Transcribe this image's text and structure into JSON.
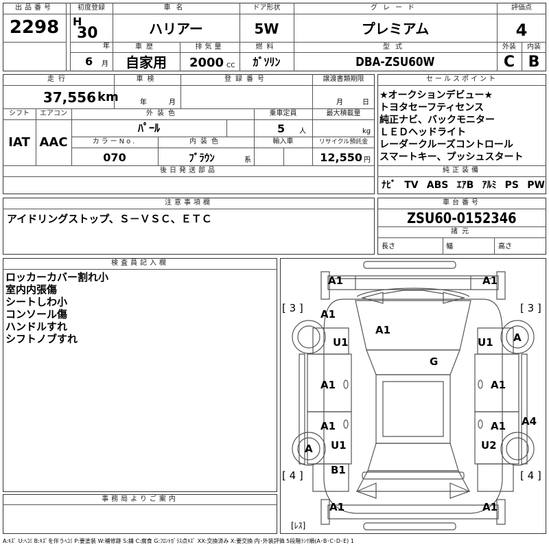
{
  "header": {
    "lot_label": "出品番号",
    "lot": "2298",
    "first_reg_label": "初度登録",
    "era": "H",
    "year": "30",
    "year_unit": "年",
    "month": "6",
    "month_unit": "月",
    "car_name_label": "車名",
    "car_name": "ハリアー",
    "door_label": "ドア形状",
    "door": "5W",
    "grade_label": "グレード",
    "grade": "プレミアム",
    "score_label": "評価点",
    "score": "4",
    "history_label": "車歴",
    "history": "自家用",
    "displacement_label": "排気量",
    "displacement": "2000",
    "displacement_unit": "CC",
    "fuel_label": "燃料",
    "fuel": "ｶﾞｿﾘﾝ",
    "model_label": "型式",
    "model": "DBA-ZSU60W",
    "exterior_label": "外装",
    "exterior": "C",
    "interior_label": "内装",
    "interior": "B"
  },
  "specs": {
    "mileage_label": "走行",
    "mileage": "37,556",
    "mileage_unit": "km",
    "inspection_label": "車検",
    "inspection_year_unit": "年",
    "inspection_month_unit": "月",
    "reg_no_label": "登録番号",
    "transfer_label": "譲渡書類期限",
    "transfer_month_unit": "月",
    "transfer_day_unit": "日",
    "shift_label": "シフト",
    "shift": "IAT",
    "aircon_label": "エアコン",
    "aircon": "AAC",
    "color_label": "外装色",
    "color": "ﾊﾟｰﾙ",
    "capacity_label": "乗車定員",
    "capacity": "5",
    "capacity_unit": "人",
    "load_label": "最大積載量",
    "load_unit": "kg",
    "color_no_label": "カラーNo.",
    "color_no": "070",
    "interior_color_label": "内装色",
    "interior_color": "ﾌﾞﾗｳﾝ",
    "interior_color_suffix": "系",
    "import_label": "輸入車",
    "recycle_label": "リサイクル預託金",
    "recycle": "12,550",
    "recycle_unit": "円",
    "later_label": "後日発送部品"
  },
  "sales_points": {
    "label": "セールスポイント",
    "items": [
      "★オークションデビュー★",
      "トヨタセーフティセンス",
      "純正ナビ、バックモニター",
      "ＬＥＤヘッドライト",
      "レーダークルーズコントロール",
      "スマートキー、プッシュスタート"
    ]
  },
  "equipment": {
    "label": "純正装備",
    "items": [
      "ﾅﾋﾞ",
      "TV",
      "ABS",
      "ｴｱB",
      "ｱﾙﾐ",
      "PS",
      "PW"
    ]
  },
  "notes": {
    "label": "注意事項欄",
    "text": "アイドリングストップ、Ｓ－ＶＳＣ、ＥＴＣ"
  },
  "chassis": {
    "label": "車台番号",
    "number": "ZSU60-0152346",
    "dims_label": "諸元",
    "length_label": "長さ",
    "width_label": "幅",
    "height_label": "高さ"
  },
  "inspector": {
    "label": "検査員記入欄",
    "lines": [
      "ロッカーカバー割れ小",
      "室内内張傷",
      "シートしわ小",
      "コンソール傷",
      "ハンドルすれ",
      "シフトノブすれ"
    ]
  },
  "office": {
    "label": "事務局よりご案内"
  },
  "diagram": {
    "marks": {
      "front_left_bumper": "A1",
      "front_right_bumper": "A1",
      "tire_fl": "[ 3 ]",
      "tire_fr": "[ 3 ]",
      "fender_fl": "A1",
      "hood": "A1",
      "door_fl_u": "U1",
      "door_fr_u": "U1",
      "wheel_fr": "A",
      "windshield": "G",
      "door_fl": "A1",
      "door_fr": "A1",
      "door_rl": "A1",
      "door_rr": "A1",
      "quarter_rr": "A4",
      "wheel_rl": "A",
      "rocker_rl": "U1",
      "rocker_rr": "U2",
      "tire_rl": "[ 4 ]",
      "tire_rr": "[ 4 ]",
      "quarter_rl": "B1",
      "rear_left_bumper": "A1",
      "rear_right_bumper": "A1",
      "spare": "[ﾚｽ]"
    }
  },
  "legend": "A:ｷｽﾞ U:ﾍｺﾐ B:ｷｽﾞを伴うﾍｺﾐ P:要塗装 W:補修跡 S:錆 C:腐食 G:ﾌﾛﾝﾄｶﾞﾗｽ点ｷｽﾞ XX:交換済み X:要交換 内･外装評価 5段階ﾗﾝｸ順(A･B･C･D･E) 1"
}
